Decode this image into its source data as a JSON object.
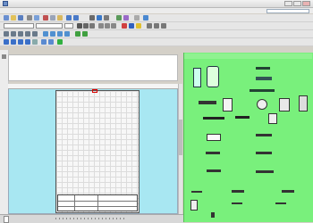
{
  "window": {
    "title": ""
  },
  "menu": {
    "items": [
      "",
      "",
      "",
      "",
      "",
      "",
      "",
      "",
      ""
    ]
  },
  "toolbar": {
    "font_value": "",
    "size_value": ""
  },
  "header_panel": {
    "label": ""
  },
  "library": {
    "title": ""
  },
  "title_block": {
    "cells": [
      "",
      "",
      "",
      ""
    ]
  },
  "status": {
    "page_tab": ""
  },
  "colors": {
    "library_bg": "#79f07c",
    "drawing_bg": "#a8e7f2",
    "sheet_bg": "#f7f7f7"
  }
}
